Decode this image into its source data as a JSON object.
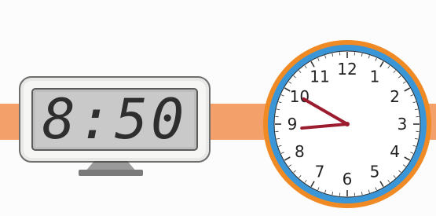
{
  "digital_clock": {
    "time": "8:50"
  },
  "analog_clock": {
    "numbers": [
      "12",
      "1",
      "2",
      "3",
      "4",
      "5",
      "6",
      "7",
      "8",
      "9",
      "10",
      "11"
    ],
    "hour_hand": "clock-hand",
    "minute_hand": "clock-hand"
  },
  "colors": {
    "band": "#f4a06a",
    "clock_rim_outer": "#f08a24",
    "clock_rim_inner": "#3a96d6",
    "hands": "#9b1c2e"
  }
}
